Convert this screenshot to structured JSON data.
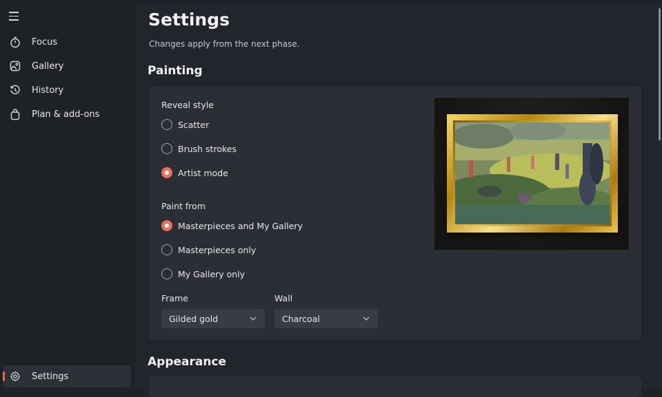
{
  "sidebar": {
    "items": [
      {
        "label": "Focus",
        "icon": "stopwatch-icon"
      },
      {
        "label": "Gallery",
        "icon": "image-icon"
      },
      {
        "label": "History",
        "icon": "history-icon"
      },
      {
        "label": "Plan & add-ons",
        "icon": "shopping-bag-icon"
      }
    ],
    "settings": {
      "label": "Settings",
      "icon": "gear-icon",
      "active": true
    }
  },
  "page": {
    "title": "Settings",
    "subtitle": "Changes apply from the next phase."
  },
  "painting": {
    "title": "Painting",
    "reveal_style": {
      "label": "Reveal style",
      "options": [
        "Scatter",
        "Brush strokes",
        "Artist mode"
      ],
      "selected": "Artist mode"
    },
    "paint_from": {
      "label": "Paint from",
      "options": [
        "Masterpieces and My Gallery",
        "Masterpieces only",
        "My Gallery only"
      ],
      "selected": "Masterpieces and My Gallery"
    },
    "frame": {
      "label": "Frame",
      "value": "Gilded gold"
    },
    "wall": {
      "label": "Wall",
      "value": "Charcoal"
    }
  },
  "appearance": {
    "title": "Appearance"
  },
  "colors": {
    "accent": "#e8735a",
    "background": "#22262c",
    "card": "#2b2f35"
  }
}
